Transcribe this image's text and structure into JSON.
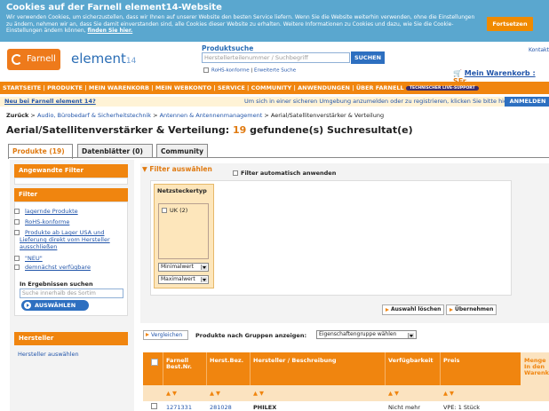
{
  "cookie": {
    "title": "Cookies auf der Farnell element14-Website",
    "body": "Wir verwenden Cookies, um sicherzustellen, dass wir Ihnen auf unserer Website den besten Service liefern. Wenn Sie die Website weiterhin verwenden, ohne die Einstellungen zu ändern, nehmen wir an, dass Sie damit einverstanden sind, alle Cookies dieser Website zu erhalten. Weitere Informationen zu Cookies und dazu, wie Sie die Cookie-Einstellungen ändern können,",
    "link": "finden Sie hier.",
    "button": "Fortsetzen"
  },
  "header": {
    "logo_text": "Farnell",
    "brand": "element",
    "brand_num": "14",
    "product_search_label": "Produktsuche",
    "search_placeholder": "Herstellerteilenummer / Suchbegriff",
    "search_button": "SUCHEN",
    "rohs_label": "RoHS-konforme",
    "advanced_search": "Erweiterte Suche",
    "contact": "Kontakt",
    "cart_label": "Mein Warenkorb :",
    "cart_value": "SFr."
  },
  "nav": {
    "items": "STARTSEITE | PRODUKTE | MEIN WARENKORB | MEIN WEBKONTO | SERVICE | COMMUNITY | ANWENDUNGEN | ÜBER FARNELL",
    "badge": "TECHNISCHER LIVE-SUPPORT"
  },
  "newbar": {
    "left": "Neu bei Farnell element 14?",
    "right": "Um sich in einer sicheren Umgebung anzumelden oder zu registrieren, klicken Sie bitte hier",
    "button": "ANMELDEN"
  },
  "breadcrumb": {
    "prefix": "Zurück",
    "items": [
      "Audio, Bürobedarf & Sicherheitstechnik",
      "Antennen & Antennenmanagement",
      "Aerial/Satellitenverstärker & Verteilung"
    ]
  },
  "title": {
    "main": "Aerial/Satellitenverstärker & Verteilung:",
    "count": "19",
    "suffix": "gefundene(s) Suchresultat(e)"
  },
  "tabs": [
    "Produkte (19)",
    "Datenblätter (0)",
    "Community"
  ],
  "left": {
    "applied_filter": "Angewandte Filter",
    "filter": "Filter",
    "filter_items": [
      "lagernde Produkte",
      "RoHS-konforme",
      "Produkte ab Lager USA und Lieferung direkt vom Hersteller ausschließen",
      "\"NEU\"",
      "demnächst verfügbare"
    ],
    "in_results": "In Ergebnissen suchen",
    "in_results_placeholder": "Suche innerhalb des Sortim",
    "select_button": "AUSWÄHLEN",
    "manufacturer": "Hersteller",
    "manufacturer_link": "Hersteller auswählen"
  },
  "filterpanel": {
    "heading": "Filter auswählen",
    "auto_apply": "Filter automatisch anwenden",
    "group_label": "Netzsteckertyp",
    "option": "UK (2)",
    "min_select": "Minimalwert",
    "max_select": "Maximalwert",
    "clear_button": "Auswahl löschen",
    "apply_button": "Übernehmen"
  },
  "table": {
    "compare_button": "Vergleichen",
    "group_label": "Produkte nach Gruppen anzeigen:",
    "group_select": "Eigenschaftengruppe wählen",
    "headers": [
      "Farnell Best.Nr.",
      "Herst.Bez.",
      "Hersteller / Beschreibung",
      "Verfügbarkeit",
      "Preis",
      "Menge In den Warenk."
    ],
    "sort_glyph": "▲▼",
    "row": [
      "1271331",
      "281028",
      "PHILEX",
      "Nicht mehr",
      "VPE: 1 Stück"
    ]
  }
}
